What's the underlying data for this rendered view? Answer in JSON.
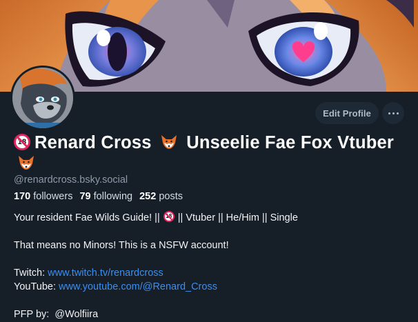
{
  "banner": {
    "description_icon": "banner-art"
  },
  "profile": {
    "display_name_parts": [
      "Renard Cross",
      "Unseelie Fae Fox",
      "Vtuber"
    ],
    "handle": "@renardcross.bsky.social",
    "followers_count": "170",
    "followers_label": "followers",
    "following_count": "79",
    "following_label": "following",
    "posts_count": "252",
    "posts_label": "posts",
    "edit_button_label": "Edit Profile",
    "adult_badge_text": "18"
  },
  "bio": {
    "line1_before": "Your resident Fae Wilds Guide! ||",
    "line1_after": "|| Vtuber || He/Him || Single",
    "line2": "That means no Minors! This is a NSFW account!",
    "twitch_label": "Twitch:",
    "twitch_link": "www.twitch.tv/renardcross",
    "youtube_label": "YouTube:",
    "youtube_link": "www.youtube.com/@Renard_Cross",
    "pfp_label": "PFP by:",
    "pfp_credit": "@Wolfiira"
  },
  "colors": {
    "background": "#161e27",
    "link": "#3b8ff0",
    "button_bg": "#1e2936",
    "badge_red": "#e0245e"
  }
}
